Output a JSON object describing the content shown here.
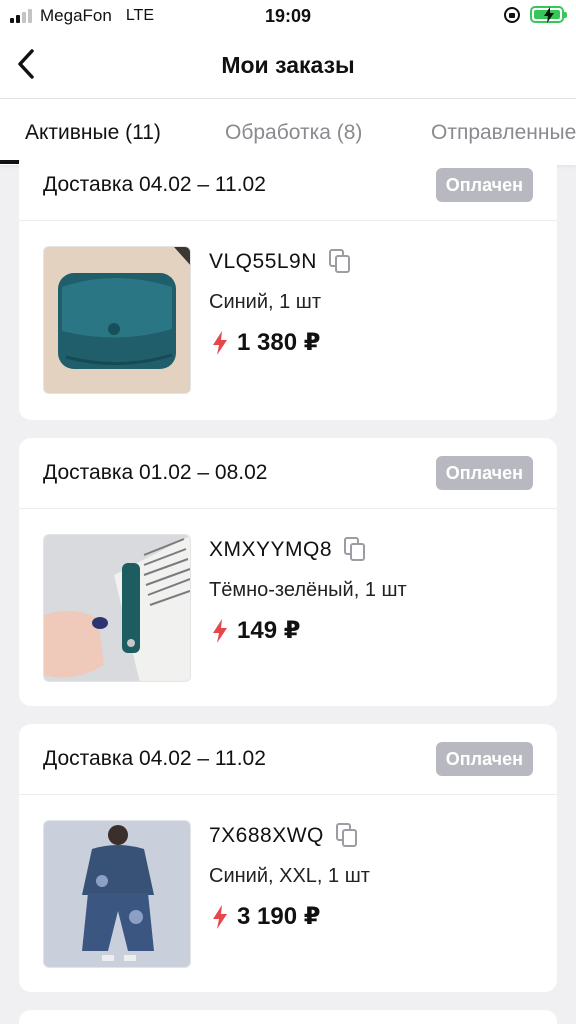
{
  "status_bar": {
    "carrier": "MegaFon",
    "network": "LTE",
    "time": "19:09"
  },
  "header": {
    "title": "Мои заказы"
  },
  "tabs": [
    {
      "label": "Активные (11)",
      "active": true
    },
    {
      "label": "Обработка (8)",
      "active": false
    },
    {
      "label": "Отправленные",
      "active": false
    }
  ],
  "colors": {
    "badge": "#b8b8c0",
    "lightning": "#e5474b",
    "battery": "#35c759"
  },
  "orders": [
    {
      "delivery": "Доставка 04.02 – 11.02",
      "status": "Оплачен",
      "code": "VLQ55L9N",
      "variant": "Синий, 1 шт",
      "price": "1 380 ₽",
      "image": "teal-leather-wallet"
    },
    {
      "delivery": "Доставка 01.02 – 08.02",
      "status": "Оплачен",
      "code": "XMXYYMQ8",
      "variant": "Тёмно-зелёный, 1 шт",
      "price": "149 ₽",
      "image": "green-leather-strap"
    },
    {
      "delivery": "Доставка 04.02 – 11.02",
      "status": "Оплачен",
      "code": "7X688XWQ",
      "variant": "Синий, XXL, 1 шт",
      "price": "3 190 ₽",
      "image": "denim-outfit"
    }
  ]
}
